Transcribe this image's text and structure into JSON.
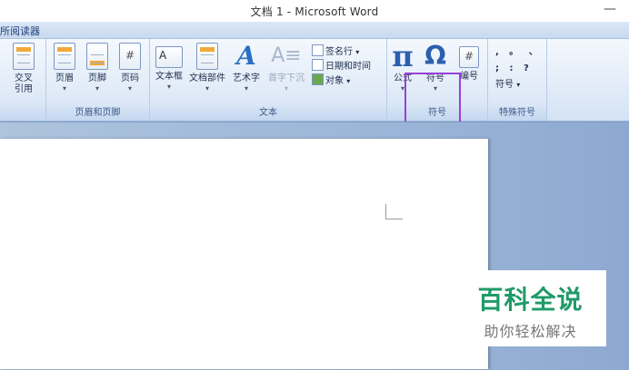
{
  "window": {
    "title": "文档 1 - Microsoft Word",
    "minimize": "—"
  },
  "tabs": {
    "partial_tab": "所阅读器"
  },
  "groups": {
    "left_partial": {
      "label": ""
    },
    "header_footer": {
      "label": "页眉和页脚"
    },
    "text": {
      "label": "文本"
    },
    "symbols": {
      "label": "符号"
    },
    "special": {
      "label": "特殊符号"
    }
  },
  "buttons": {
    "cross_ref": {
      "line1": "交叉",
      "line2": "引用"
    },
    "header": {
      "label": "页眉"
    },
    "footer": {
      "label": "页脚"
    },
    "page_number": {
      "label": "页码"
    },
    "text_box": {
      "label": "文本框"
    },
    "quick_parts": {
      "label": "文档部件"
    },
    "wordart": {
      "label": "艺术字"
    },
    "drop_cap": {
      "label": "首字下沉"
    },
    "signature_line": {
      "label": "签名行"
    },
    "date_time": {
      "label": "日期和时间"
    },
    "object": {
      "label": "对象"
    },
    "equation": {
      "label": "公式",
      "glyph": "π"
    },
    "symbol": {
      "label": "符号",
      "glyph": "Ω"
    },
    "numbering": {
      "label": "编号",
      "glyph": "#"
    },
    "special_row1": ", 。 、",
    "special_row2": "; : ?",
    "special_symbol": {
      "label": "符号"
    }
  },
  "chevron": "▾",
  "watermark": {
    "title": "百科全说",
    "subtitle": "助你轻松解决"
  },
  "colors": {
    "highlight": "#9b3fd6",
    "watermark_green": "#1f9a68",
    "accent_blue": "#2b5fae"
  }
}
